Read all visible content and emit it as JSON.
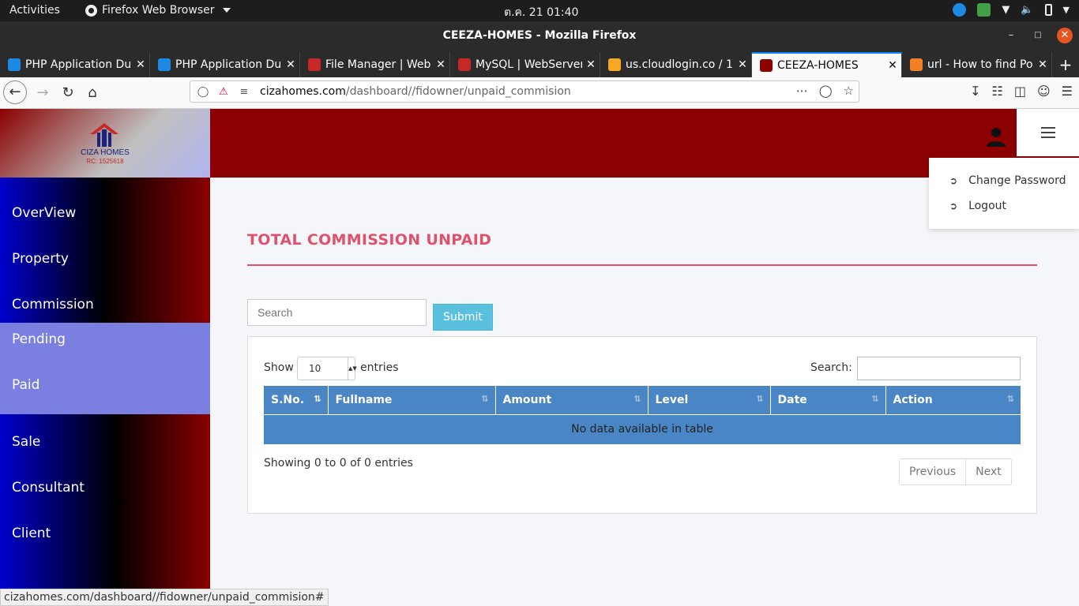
{
  "gnome": {
    "activities": "Activities",
    "app_menu": "Firefox Web Browser",
    "clock": "ต.ค. 21  01:40"
  },
  "window": {
    "title": "CEEZA-HOMES - Mozilla Firefox"
  },
  "tabs": [
    {
      "label": "PHP Application Du",
      "color": "#1e88e5"
    },
    {
      "label": "PHP Application Du",
      "color": "#1e88e5"
    },
    {
      "label": "File Manager | Web",
      "color": "#c62828"
    },
    {
      "label": "MySQL | WebServer",
      "color": "#c62828"
    },
    {
      "label": "us.cloudlogin.co / 1",
      "color": "#f9a825"
    },
    {
      "label": "CEEZA-HOMES",
      "color": "#8b0000"
    },
    {
      "label": "url - How to find Po",
      "color": "#f48024"
    }
  ],
  "nav": {
    "url_domain": "cizahomes.com",
    "url_path": "/dashboard//fidowner/unpaid_commision"
  },
  "brand": {
    "name": "CIZA HOMES",
    "rc": "RC: 1525618"
  },
  "sidebar": {
    "items": [
      {
        "label": "OverView"
      },
      {
        "label": "Property"
      },
      {
        "label": "Commission"
      },
      {
        "label": "Pending"
      },
      {
        "label": "Paid"
      },
      {
        "label": "Sale"
      },
      {
        "label": "Consultant"
      },
      {
        "label": "Client"
      }
    ]
  },
  "user_menu": {
    "items": [
      {
        "label": "Change Password"
      },
      {
        "label": "Logout"
      }
    ]
  },
  "main": {
    "title": "TOTAL COMMISSION UNPAID",
    "search_placeholder": "Search",
    "submit_label": "Submit",
    "table": {
      "show_label": "Show",
      "page_length": "10",
      "entries_label": "entries",
      "search_label": "Search:",
      "columns": [
        "S.No.",
        "Fullname",
        "Amount",
        "Level",
        "Date",
        "Action"
      ],
      "empty_message": "No data available in table",
      "info": "Showing 0 to 0 of 0 entries",
      "prev_label": "Previous",
      "next_label": "Next"
    }
  },
  "status_bar": {
    "text": "cizahomes.com/dashboard//fidowner/unpaid_commision#"
  },
  "colors": {
    "brand_dark_red": "#8b0000",
    "title_accent": "#e0526c",
    "table_header": "#4a86c5",
    "submit_button": "#5bc0de",
    "submenu_bg": "#7b7fe0"
  }
}
